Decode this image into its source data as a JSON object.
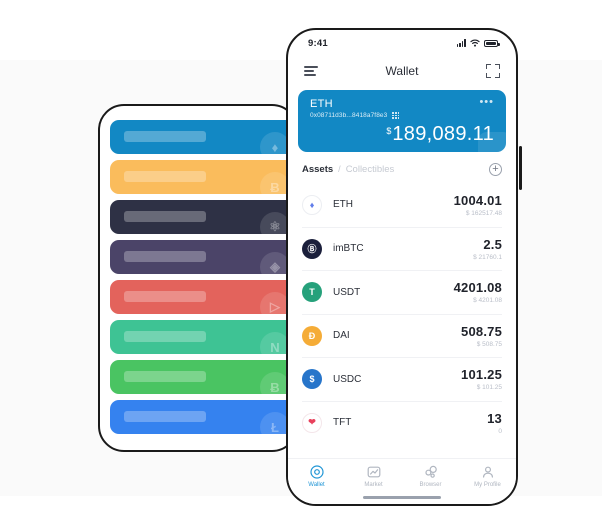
{
  "left_phone": {
    "name": "wallet-card-stack-placeholder",
    "cards": [
      {
        "color": "#1288c4",
        "symbol": "eth-watermark-icon",
        "glyph": "♦"
      },
      {
        "color": "#fabc5c",
        "symbol": "btc-watermark-icon",
        "glyph": "Ƀ"
      },
      {
        "color": "#2e3145",
        "symbol": "atom-watermark-icon",
        "glyph": "⚛"
      },
      {
        "color": "#4b4468",
        "symbol": "eos-watermark-icon",
        "glyph": "◈"
      },
      {
        "color": "#e3635c",
        "symbol": "trx-watermark-icon",
        "glyph": "▷"
      },
      {
        "color": "#3ec394",
        "symbol": "neo-watermark-icon",
        "glyph": "N"
      },
      {
        "color": "#4ac462",
        "symbol": "bch-watermark-icon",
        "glyph": "Ƀ"
      },
      {
        "color": "#3582ef",
        "symbol": "ltc-watermark-icon",
        "glyph": "Ł"
      }
    ]
  },
  "status_bar": {
    "time": "9:41",
    "signal_icon": "cellular-signal-icon",
    "wifi_icon": "wifi-icon",
    "battery_icon": "battery-icon"
  },
  "app_bar": {
    "menu_icon": "hamburger-menu-icon",
    "title": "Wallet",
    "scan_icon": "scan-qr-icon"
  },
  "account_card": {
    "name": "ETH",
    "address": "0x08711d3b...8418a7f8e3",
    "qr_icon": "qr-code-icon",
    "more_icon": "more-options-icon",
    "more_glyph": "•••",
    "currency_symbol": "$",
    "balance": "189,089.11",
    "background_color": "#1288c4"
  },
  "assets_header": {
    "tab_active": "Assets",
    "separator": "/",
    "tab_inactive": "Collectibles",
    "add_icon": "add-asset-icon",
    "add_glyph": "+"
  },
  "assets": [
    {
      "symbol": "ETH",
      "amount": "1004.01",
      "fiat": "$ 162517.48",
      "icon": "eth-coin-icon",
      "glyph": "♦"
    },
    {
      "symbol": "imBTC",
      "amount": "2.5",
      "fiat": "$ 21760.1",
      "icon": "imbtc-coin-icon",
      "glyph": "Ⓑ"
    },
    {
      "symbol": "USDT",
      "amount": "4201.08",
      "fiat": "$ 4201.08",
      "icon": "usdt-coin-icon",
      "glyph": "T"
    },
    {
      "symbol": "DAI",
      "amount": "508.75",
      "fiat": "$ 508.75",
      "icon": "dai-coin-icon",
      "glyph": "Đ"
    },
    {
      "symbol": "USDC",
      "amount": "101.25",
      "fiat": "$ 101.25",
      "icon": "usdc-coin-icon",
      "glyph": "$"
    },
    {
      "symbol": "TFT",
      "amount": "13",
      "fiat": "0",
      "icon": "tft-coin-icon",
      "glyph": "❤"
    }
  ],
  "tab_bar": {
    "items": [
      {
        "label": "Wallet",
        "icon": "wallet-tab-icon",
        "active": true
      },
      {
        "label": "Market",
        "icon": "market-tab-icon",
        "active": false
      },
      {
        "label": "Browser",
        "icon": "browser-tab-icon",
        "active": false
      },
      {
        "label": "My Profile",
        "icon": "profile-tab-icon",
        "active": false
      }
    ],
    "home_indicator": "home-indicator"
  },
  "theme": {
    "accent": "#1288c4",
    "tab_active_color": "#2196d6",
    "muted_text": "#b9bec8",
    "panel_bg": "#fafafa"
  }
}
